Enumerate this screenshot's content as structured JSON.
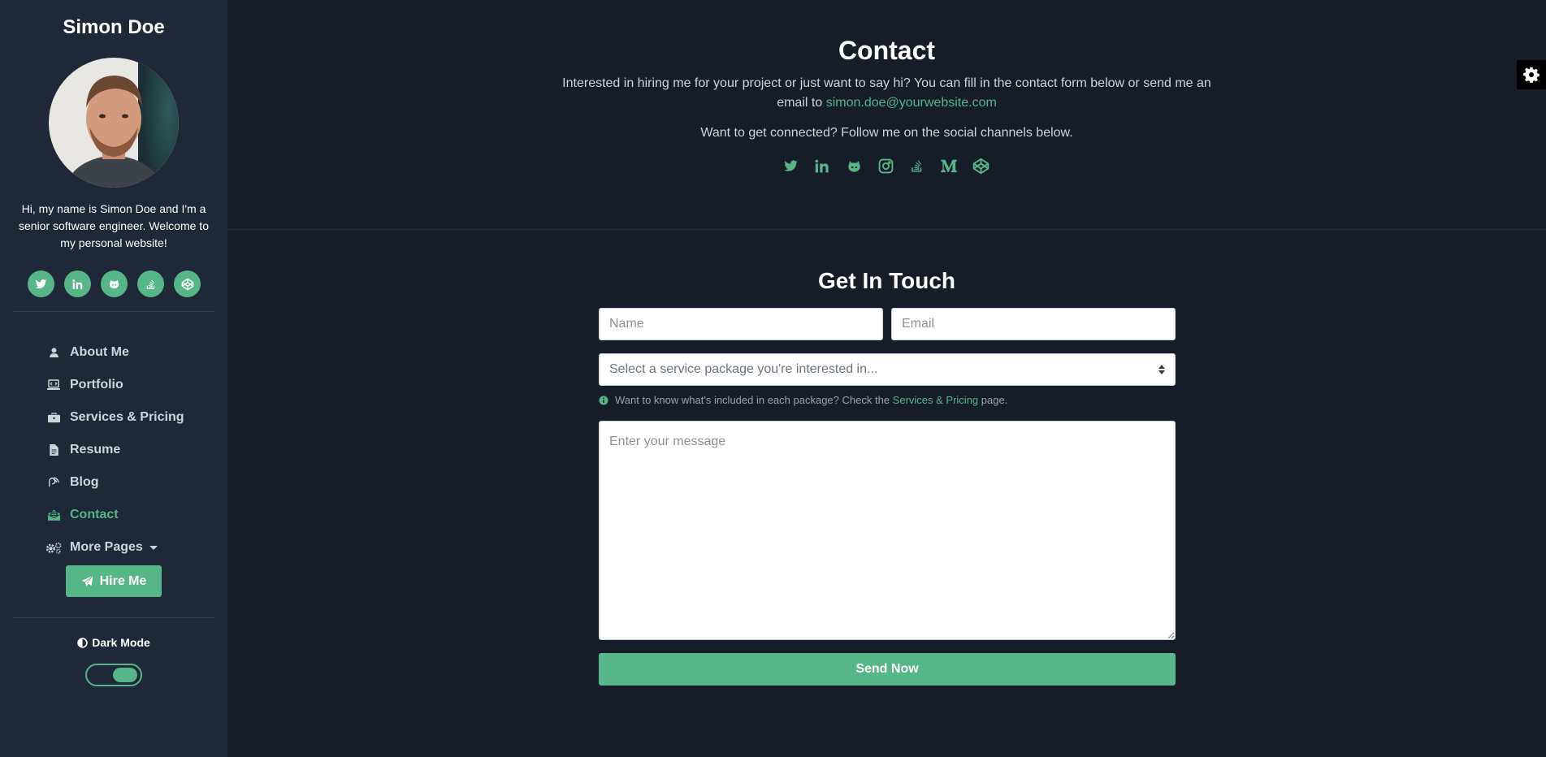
{
  "sidebar": {
    "name": "Simon Doe",
    "bio": "Hi, my name is Simon Doe and I'm a senior software engineer. Welcome to my personal website!",
    "social_icons": [
      "twitter-icon",
      "linkedin-icon",
      "github-icon",
      "stack-overflow-icon",
      "codepen-icon"
    ],
    "nav": [
      {
        "label": "About Me",
        "icon": "user-icon"
      },
      {
        "label": "Portfolio",
        "icon": "laptop-code-icon"
      },
      {
        "label": "Services & Pricing",
        "icon": "briefcase-icon"
      },
      {
        "label": "Resume",
        "icon": "file-icon"
      },
      {
        "label": "Blog",
        "icon": "blog-icon"
      },
      {
        "label": "Contact",
        "icon": "envelope-open-icon",
        "active": true
      },
      {
        "label": "More Pages",
        "icon": "cogs-icon"
      }
    ],
    "hire_label": "Hire Me",
    "dark_mode_label": "Dark Mode",
    "dark_mode_on": true
  },
  "contact": {
    "title": "Contact",
    "intro_text": "Interested in hiring me for your project or just want to say hi? You can fill in the contact form below or send me an email to",
    "email": "simon.doe@yourwebsite.com",
    "follow_text": "Want to get connected? Follow me on the social channels below.",
    "social_icons": [
      "twitter-icon",
      "linkedin-icon",
      "github-icon",
      "instagram-icon",
      "stack-overflow-icon",
      "medium-icon",
      "codepen-icon"
    ]
  },
  "form": {
    "title": "Get In Touch",
    "name_placeholder": "Name",
    "email_placeholder": "Email",
    "select_placeholder": "Select a service package you're interested in...",
    "hint_text": "Want to know what's included in each package? Check the",
    "hint_link": "Services & Pricing",
    "hint_suffix": "page.",
    "message_placeholder": "Enter your message",
    "send_label": "Send Now"
  },
  "colors": {
    "accent": "#56b687",
    "sidebar_bg": "#1e2838",
    "page_bg": "#161d28"
  }
}
